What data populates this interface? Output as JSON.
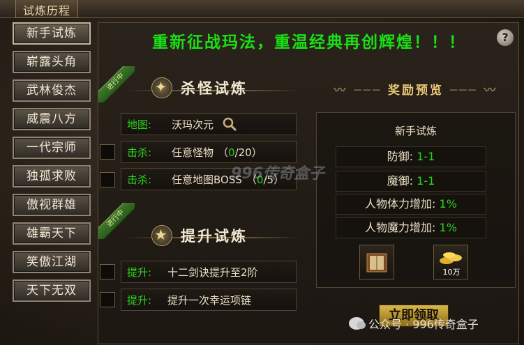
{
  "window": {
    "title": "试炼历程"
  },
  "sidebar": {
    "items": [
      {
        "label": "新手试炼",
        "active": true
      },
      {
        "label": "崭露头角"
      },
      {
        "label": "武林俊杰"
      },
      {
        "label": "威震八方"
      },
      {
        "label": "一代宗师"
      },
      {
        "label": "独孤求败"
      },
      {
        "label": "傲视群雄"
      },
      {
        "label": "雄霸天下"
      },
      {
        "label": "笑傲江湖"
      },
      {
        "label": "天下无双"
      }
    ]
  },
  "banner": {
    "text": "重新征战玛法，重温经典再创辉煌！！！"
  },
  "help": {
    "label": "?"
  },
  "kill": {
    "ribbon": "进行中",
    "title": "杀怪试炼",
    "map_key": "地图:",
    "map_value": "沃玛次元",
    "tasks": [
      {
        "key": "击杀:",
        "name": "任意怪物",
        "progress": "0",
        "total": "/20"
      },
      {
        "key": "击杀:",
        "name": "任意地图BOSS",
        "progress": "0",
        "total": "/5"
      }
    ]
  },
  "upgrade": {
    "ribbon": "进行中",
    "title": "提升试炼",
    "tasks": [
      {
        "key": "提升:",
        "name": "十二剑诀提升至2阶"
      },
      {
        "key": "提升:",
        "name": "提升一次幸运项链"
      }
    ]
  },
  "reward": {
    "title": "奖励预览",
    "name": "新手试炼",
    "stats": [
      {
        "label": "防御:",
        "value": "1-1"
      },
      {
        "label": "魔御:",
        "value": "1-1"
      },
      {
        "label": "人物体力增加:",
        "value": "1%"
      },
      {
        "label": "人物魔力增加:",
        "value": "1%"
      }
    ],
    "items": [
      {
        "icon": "book-icon",
        "label": ""
      },
      {
        "icon": "gold-coins-icon",
        "label": "10万"
      }
    ],
    "claim": "立即领取"
  },
  "watermark": "996传奇盒子",
  "footer": {
    "wechat": "公众号 · 996传奇盒子"
  },
  "colors": {
    "green": "#29d21f",
    "banner": "#19e015"
  }
}
